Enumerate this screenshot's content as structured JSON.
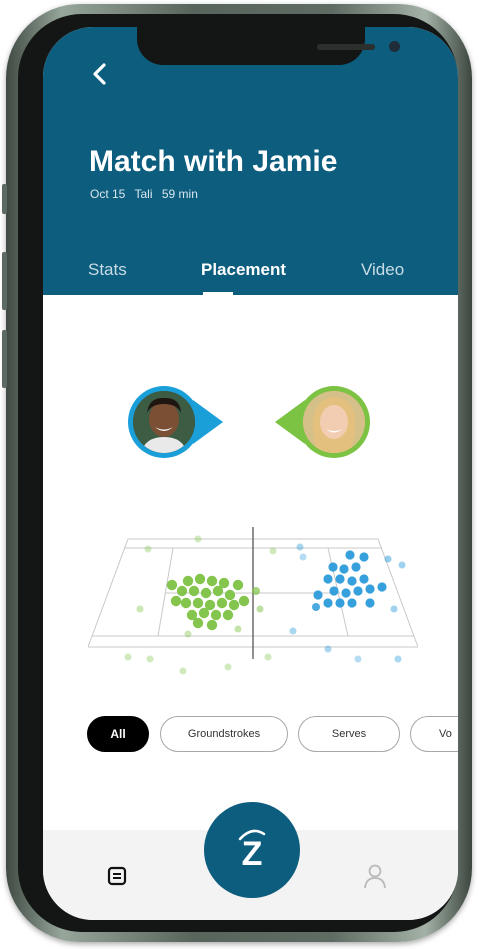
{
  "header": {
    "title": "Match with Jamie",
    "meta": {
      "date": "Oct 15",
      "location": "Tali",
      "duration": "59 min"
    },
    "back_icon": "chevron-left-icon"
  },
  "tabs": [
    {
      "label": "Stats",
      "active": false
    },
    {
      "label": "Placement",
      "active": true
    },
    {
      "label": "Video",
      "active": false
    }
  ],
  "players": {
    "left": {
      "name": "player",
      "marker_color": "#1a9fd9",
      "icon": "avatar-left"
    },
    "right": {
      "name": "opponent",
      "marker_color": "#7cc243",
      "icon": "avatar-right"
    }
  },
  "court": {
    "player_shot_color": "#7cc243",
    "opponent_shot_color": "#2a9bd9"
  },
  "filters": [
    {
      "label": "All",
      "active": true
    },
    {
      "label": "Groundstrokes",
      "active": false
    },
    {
      "label": "Serves",
      "active": false
    },
    {
      "label": "Vo",
      "active": false
    }
  ],
  "bottom_nav": {
    "left_icon": "list-icon",
    "center_label": "Z",
    "right_icon": "profile-icon"
  },
  "colors": {
    "brand": "#0d5d7e",
    "accent_green": "#7cc243",
    "accent_blue": "#2a9bd9"
  }
}
